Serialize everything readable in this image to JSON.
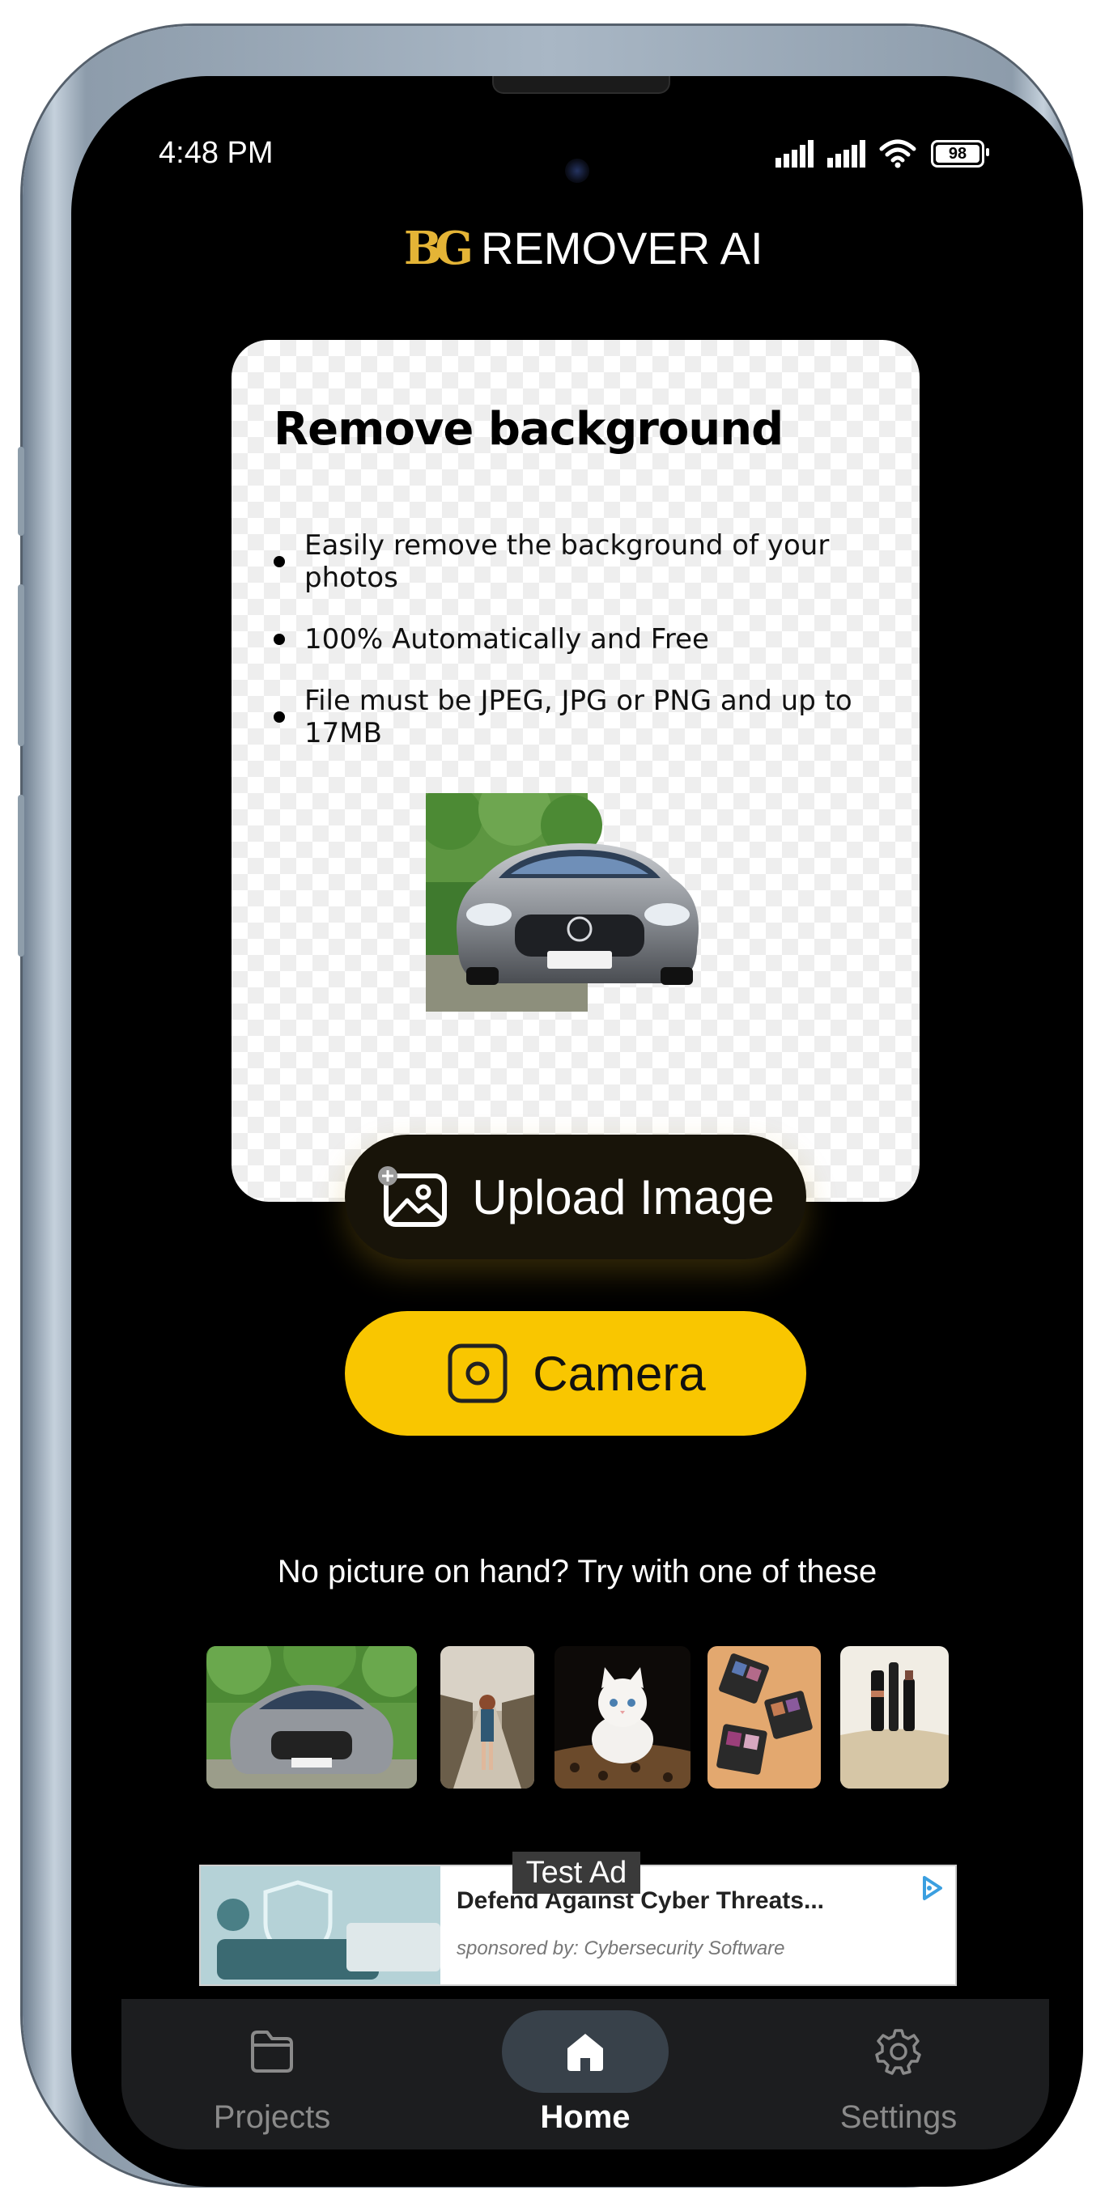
{
  "status_bar": {
    "time": "4:48 PM",
    "battery": "98",
    "icons": [
      "signal-icon",
      "signal-icon",
      "wifi-icon",
      "battery-icon"
    ]
  },
  "header": {
    "logo_text": "BG",
    "title": "REMOVER AI"
  },
  "card": {
    "title": "Remove background",
    "bullets": [
      "Easily remove the background of your photos",
      "100% Automatically and Free",
      "File must be JPEG, JPG or PNG and up to 17MB"
    ]
  },
  "actions": {
    "upload_label": "Upload Image",
    "camera_label": "Camera"
  },
  "samples": {
    "prompt": "No picture on hand? Try with one of these",
    "items": [
      "car",
      "woman on road",
      "kitten",
      "eyeshadow palette",
      "cosmetics"
    ]
  },
  "ad": {
    "badge": "Test Ad",
    "title": "Defend Against Cyber Threats...",
    "sponsor": "sponsored by: Cybersecurity Software"
  },
  "nav": {
    "items": [
      {
        "label": "Projects",
        "icon": "folder-icon"
      },
      {
        "label": "Home",
        "icon": "home-icon",
        "active": true
      },
      {
        "label": "Settings",
        "icon": "gear-icon"
      }
    ]
  },
  "colors": {
    "accent": "#f9c600",
    "background": "#000000",
    "nav_background": "#1c1d1f",
    "nav_active_pill": "#38414a"
  }
}
